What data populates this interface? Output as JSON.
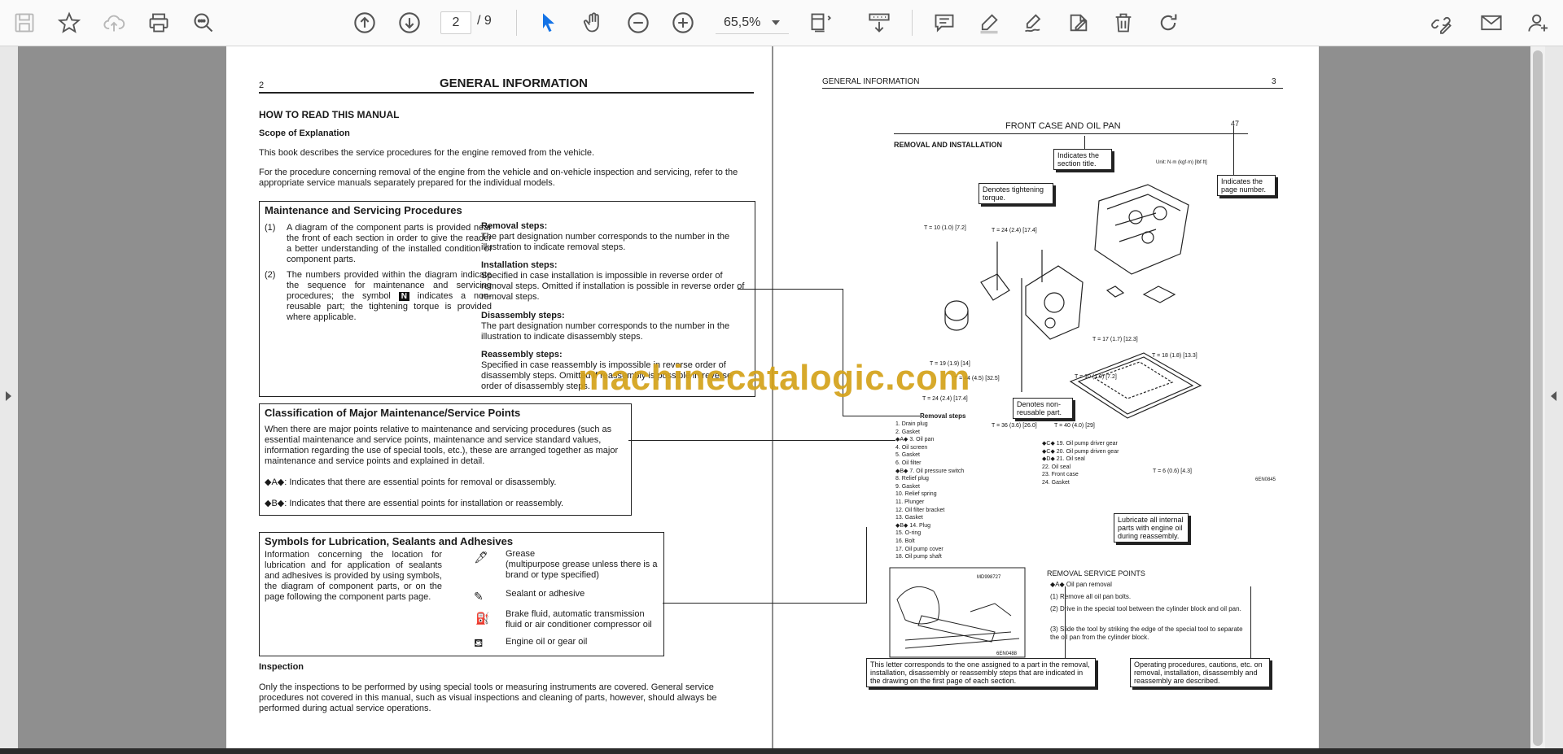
{
  "toolbar": {
    "page_current": "2",
    "page_total": "/ 9",
    "zoom": "65,5%"
  },
  "left_page": {
    "page_number": "2",
    "header_title": "GENERAL INFORMATION",
    "section_title": "HOW TO READ THIS MANUAL",
    "scope_heading": "Scope of Explanation",
    "scope_p1": "This book describes the service procedures for the engine removed from the vehicle.",
    "scope_p2": "For the procedure concerning removal of the engine from the vehicle and on-vehicle inspection and servicing, refer to the appropriate service manuals separately prepared for the individual models.",
    "maint_title": "Maintenance and Servicing Procedures",
    "maint_item1_num": "(1)",
    "maint_item1": "A diagram of the component parts is provided near the front of each section in order to give the reader a better understanding of the installed condition of component parts.",
    "maint_item2_num": "(2)",
    "maint_item2_a": "The numbers provided within the diagram indicate the sequence for maintenance and servicing procedures; the symbol",
    "maint_item2_badge": "N",
    "maint_item2_b": "indicates a non-reusable part; the tightening torque is provided where applicable.",
    "removal_h": "Removal steps:",
    "removal_t": "The part designation number corresponds to the number in the illustration to indicate removal steps.",
    "install_h": "Installation steps:",
    "install_t": "Specified in case installation is impossible in reverse order of removal steps. Omitted if installation is possible in reverse order of removal steps.",
    "disasm_h": "Disassembly steps:",
    "disasm_t": "The part designation number corresponds to the number in the illustration to indicate disassembly steps.",
    "reasm_h": "Reassembly steps:",
    "reasm_t": "Specified in case reassembly is impossible in reverse order of disassembly steps. Omitted if reassembly is possible in reverse order of disassembly steps.",
    "class_title": "Classification of Major Maintenance/Service Points",
    "class_text": "When there are major points relative to maintenance and servicing procedures (such as essential maintenance and service points, maintenance and service standard values, information regarding the use of special tools, etc.), these are arranged together as major maintenance and service points and explained in detail.",
    "class_a": "◆A◆: Indicates that there are essential points for removal or disassembly.",
    "class_b": "◆B◆: Indicates that there are essential points for installation or reassembly.",
    "sym_title": "Symbols for Lubrication, Sealants and Adhesives",
    "sym_text": "Information concerning the location for lubrication and for application of sealants and adhesives is provided by using symbols, the diagram of component parts, or on the page following the component parts page.",
    "sym_grease": "Grease",
    "sym_grease_sub": "(multipurpose grease unless there is a brand or type specified)",
    "sym_sealant": "Sealant or adhesive",
    "sym_brake": "Brake fluid, automatic transmission fluid or air conditioner compressor oil",
    "sym_engine_oil": "Engine oil or gear oil",
    "inspection_h": "Inspection",
    "inspection_t": "Only the inspections to be performed by using special tools or measuring instruments are covered. General service procedures not covered in this manual, such as visual inspections and cleaning of parts, however, should always be performed during actual service operations."
  },
  "right_page": {
    "header_title": "GENERAL INFORMATION",
    "page_number": "3",
    "diagram_title": "FRONT CASE AND OIL PAN",
    "diagram_page_ref": "47",
    "removal_install": "REMOVAL AND INSTALLATION",
    "unit_note": "Unit: N·m (kgf·m) [lbf·ft]",
    "callout_section_title": "Indicates the section title.",
    "callout_page_number": "Indicates the page number.",
    "callout_torque": "Denotes tightening torque.",
    "callout_nonreusable": "Denotes non-reusable part.",
    "callout_lubricate": "Lubricate all internal parts with engine oil during reassembly.",
    "callout_letter": "This letter corresponds to the one assigned to a part in the removal, installation, disassembly or reassembly steps that are indicated in the drawing on the first page of each section.",
    "callout_procedures": "Operating procedures, cautions, etc. on removal, installation, disassembly and reassembly are described.",
    "removal_steps_title": "Removal steps",
    "removal_steps": [
      "1. Drain plug",
      "2. Gasket",
      "◆A◆ 3. Oil pan",
      "4. Oil screen",
      "5. Gasket",
      "6. Oil filter",
      "◆B◆ 7. Oil pressure switch",
      "8. Relief plug",
      "9. Gasket",
      "10. Relief spring",
      "11. Plunger",
      "12. Oil filter bracket",
      "13. Gasket",
      "◆B◆ 14. Plug",
      "15. O-ring",
      "16. Bolt",
      "17. Oil pump cover",
      "18. Oil pump shaft"
    ],
    "removal_steps_2": [
      "◆C◆ 19. Oil pump driver gear",
      "◆C◆ 20. Oil pump driven gear",
      "◆D◆ 21. Oil seal",
      "22. Oil seal",
      "23. Front case",
      "24. Gasket"
    ],
    "torque_labels": [
      "T = 10 (1.0) [7.2]",
      "T = 24 (2.4) [17.4]",
      "T = 19 (1.9) [14]",
      "T = 44 (4.5) [32.5]",
      "T = 24 (2.4) [17.4]",
      "T = 36 (3.6) [26.0]",
      "T = 40 (4.0) [29]",
      "T = 17 (1.7) [12.3]",
      "T = 18 (1.8) [13.3]",
      "T = 10 (1.0) [7.2]",
      "T = 6 (0.6) [4.3]"
    ],
    "figure_code_1": "6EN0845",
    "figure_code_2": "MD998727",
    "figure_code_3": "6EN0488",
    "rsp_title": "REMOVAL SERVICE POINTS",
    "rsp_sub": "◆A◆ Oil pan removal",
    "rsp_1": "(1) Remove all oil pan bolts.",
    "rsp_2": "(2) Drive in the special tool between the cylinder block and oil pan.",
    "rsp_3": "(3) Slide the tool by striking the edge of the special tool to separate the oil pan from the cylinder block."
  },
  "watermark": "machinecatalogic.com"
}
